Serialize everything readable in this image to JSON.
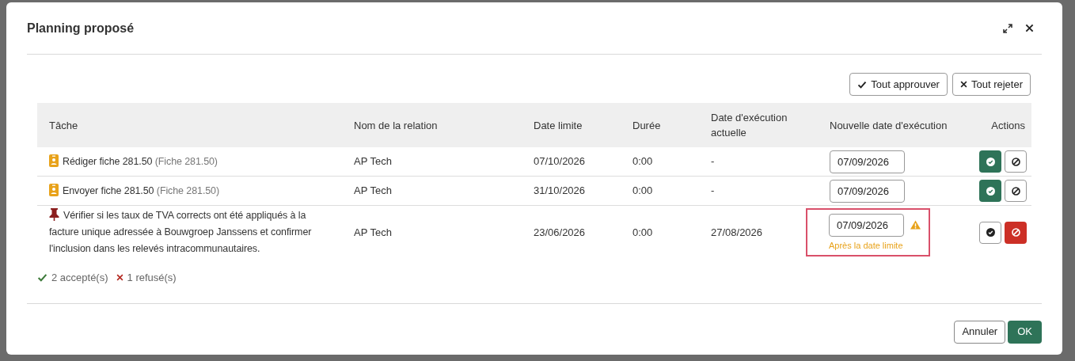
{
  "dialog": {
    "title": "Planning proposé"
  },
  "bulk_actions": [
    "Tout approuver",
    "Tout rejeter"
  ],
  "table": {
    "columns": [
      "Tâche",
      "Nom de la relation",
      "Date limite",
      "Durée",
      "Date d'exécution actuelle",
      "Nouvelle date d'exécution",
      "Actions"
    ],
    "rows": [
      {
        "kind": "badge",
        "task": "Rédiger fiche 281.50",
        "subtitle": "(Fiche 281.50)",
        "relation": "AP Tech",
        "deadline": "07/10/2026",
        "duration": "0:00",
        "current_date": "-",
        "new_date": "07/09/2026",
        "warning": null,
        "approved": true,
        "rejected": false
      },
      {
        "kind": "badge",
        "task": "Envoyer fiche 281.50",
        "subtitle": "(Fiche 281.50)",
        "relation": "AP Tech",
        "deadline": "31/10/2026",
        "duration": "0:00",
        "current_date": "-",
        "new_date": "07/09/2026",
        "warning": null,
        "approved": true,
        "rejected": false
      },
      {
        "kind": "pin",
        "task": "Vérifier si les taux de TVA corrects ont été appliqués à la facture unique adressée à Bouwgroep Janssens et confirmer l'inclusion dans les relevés intracommunautaires.",
        "relation": "AP Tech",
        "deadline": "23/06/2026",
        "duration": "0:00",
        "current_date": "27/08/2026",
        "new_date": "07/09/2026",
        "warning": "Après la date limite",
        "approved": false,
        "rejected": true
      }
    ]
  },
  "summary": {
    "accepted": "2 accepté(s)",
    "rejected": "1 refusé(s)"
  },
  "footer_buttons": [
    "Annuler",
    "OK"
  ]
}
